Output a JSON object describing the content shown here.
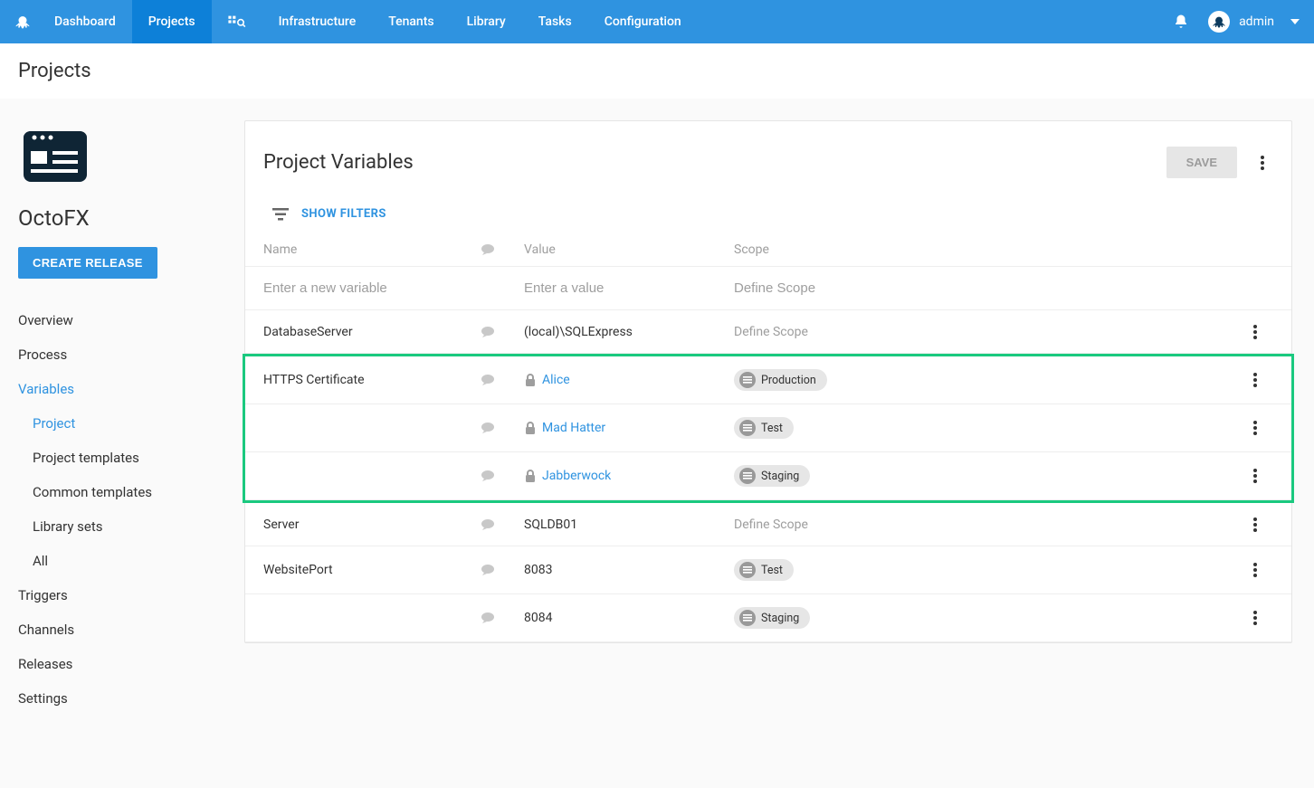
{
  "nav": {
    "items": [
      "Dashboard",
      "Projects",
      "Infrastructure",
      "Tenants",
      "Library",
      "Tasks",
      "Configuration"
    ],
    "activeIndex": 1,
    "username": "admin"
  },
  "page_title": "Projects",
  "sidebar": {
    "project_name": "OctoFX",
    "create_label": "CREATE RELEASE",
    "items": [
      {
        "label": "Overview"
      },
      {
        "label": "Process"
      },
      {
        "label": "Variables",
        "selected": true
      },
      {
        "label": "Project",
        "sub": true,
        "selected": true
      },
      {
        "label": "Project templates",
        "sub": true
      },
      {
        "label": "Common templates",
        "sub": true
      },
      {
        "label": "Library sets",
        "sub": true
      },
      {
        "label": "All",
        "sub": true
      },
      {
        "label": "Triggers"
      },
      {
        "label": "Channels"
      },
      {
        "label": "Releases"
      },
      {
        "label": "Settings"
      }
    ]
  },
  "main": {
    "title": "Project Variables",
    "save_label": "SAVE",
    "filter_label": "SHOW FILTERS",
    "columns": {
      "name": "Name",
      "value": "Value",
      "scope": "Scope"
    },
    "new_row": {
      "name_ph": "Enter a new variable",
      "value_ph": "Enter a value",
      "scope_ph": "Define Scope"
    },
    "rows": [
      {
        "name": "DatabaseServer",
        "value": "(local)\\SQLExpress",
        "scope_label": "Define Scope",
        "scope_empty": true
      },
      {
        "name": "HTTPS Certificate",
        "value": "Alice",
        "value_link": true,
        "locked": true,
        "scope_label": "Production",
        "highlighted": true
      },
      {
        "name": "",
        "value": "Mad Hatter",
        "value_link": true,
        "locked": true,
        "scope_label": "Test",
        "highlighted": true
      },
      {
        "name": "",
        "value": "Jabberwock",
        "value_link": true,
        "locked": true,
        "scope_label": "Staging",
        "highlighted": true
      },
      {
        "name": "Server",
        "value": "SQLDB01",
        "scope_label": "Define Scope",
        "scope_empty": true
      },
      {
        "name": "WebsitePort",
        "value": "8083",
        "scope_label": "Test"
      },
      {
        "name": "",
        "value": "8084",
        "scope_label": "Staging"
      }
    ]
  }
}
